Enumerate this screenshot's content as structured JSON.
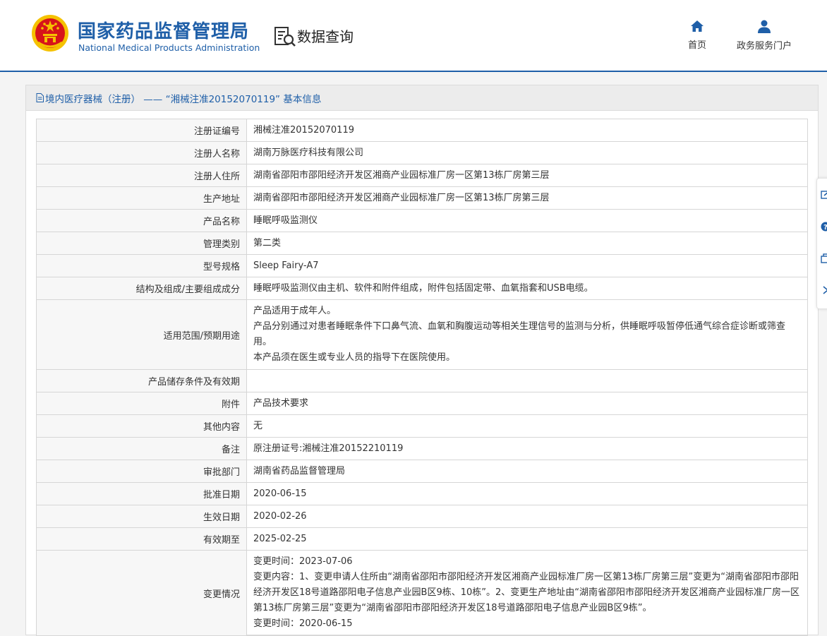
{
  "header": {
    "org_name_cn": "国家药品监督管理局",
    "org_name_en": "National Medical Products Administration",
    "section_title": "数据查询",
    "nav": [
      {
        "label": "首页",
        "icon": "home-icon"
      },
      {
        "label": "政务服务门户",
        "icon": "user-icon"
      }
    ]
  },
  "panel": {
    "title": "境内医疗器械（注册） —— “湘械注准20152070119” 基本信息",
    "rows": [
      {
        "label": "注册证编号",
        "value": [
          "湘械注准20152070119"
        ]
      },
      {
        "label": "注册人名称",
        "value": [
          "湖南万脉医疗科技有限公司"
        ]
      },
      {
        "label": "注册人住所",
        "value": [
          "湖南省邵阳市邵阳经济开发区湘商产业园标准厂房一区第13栋厂房第三层"
        ]
      },
      {
        "label": "生产地址",
        "value": [
          "湖南省邵阳市邵阳经济开发区湘商产业园标准厂房一区第13栋厂房第三层"
        ]
      },
      {
        "label": "产品名称",
        "value": [
          "睡眠呼吸监测仪"
        ]
      },
      {
        "label": "管理类别",
        "value": [
          "第二类"
        ]
      },
      {
        "label": "型号规格",
        "value": [
          "Sleep Fairy-A7"
        ]
      },
      {
        "label": "结构及组成/主要组成成分",
        "value": [
          "睡眠呼吸监测仪由主机、软件和附件组成，附件包括固定带、血氧指套和USB电缆。"
        ]
      },
      {
        "label": "适用范围/预期用途",
        "value": [
          "产品适用于成年人。",
          "产品分别通过对患者睡眠条件下口鼻气流、血氧和胸腹运动等相关生理信号的监测与分析，供睡眠呼吸暂停低通气综合症诊断或筛查用。",
          "本产品须在医生或专业人员的指导下在医院使用。"
        ]
      },
      {
        "label": "产品储存条件及有效期",
        "value": [
          ""
        ]
      },
      {
        "label": "附件",
        "value": [
          "产品技术要求"
        ]
      },
      {
        "label": "其他内容",
        "value": [
          "无"
        ]
      },
      {
        "label": "备注",
        "value": [
          "原注册证号:湘械注准20152210119"
        ]
      },
      {
        "label": "审批部门",
        "value": [
          "湖南省药品监督管理局"
        ]
      },
      {
        "label": "批准日期",
        "value": [
          "2020-06-15"
        ]
      },
      {
        "label": "生效日期",
        "value": [
          "2020-02-26"
        ]
      },
      {
        "label": "有效期至",
        "value": [
          "2025-02-25"
        ]
      },
      {
        "label": "变更情况",
        "value": [
          "变更时间：2023-07-06",
          "变更内容：1、变更申请人住所由“湖南省邵阳市邵阳经济开发区湘商产业园标准厂房一区第13栋厂房第三层”变更为“湖南省邵阳市邵阳经济开发区18号道路邵阳电子信息产业园B区9栋、10栋”。2、变更生产地址由“湖南省邵阳市邵阳经济开发区湘商产业园标准厂房一区第13栋厂房第三层”变更为“湖南省邵阳市邵阳经济开发区18号道路邵阳电子信息产业园B区9栋”。",
          "变更时间：2020-06-15"
        ]
      }
    ]
  },
  "side_toolbar": [
    "edit-icon",
    "help-icon",
    "copy-icon",
    "chevron-right-icon"
  ],
  "colors": {
    "brand": "#1f5fa8",
    "emblem_red": "#d7141a",
    "emblem_gold": "#f5c200"
  }
}
